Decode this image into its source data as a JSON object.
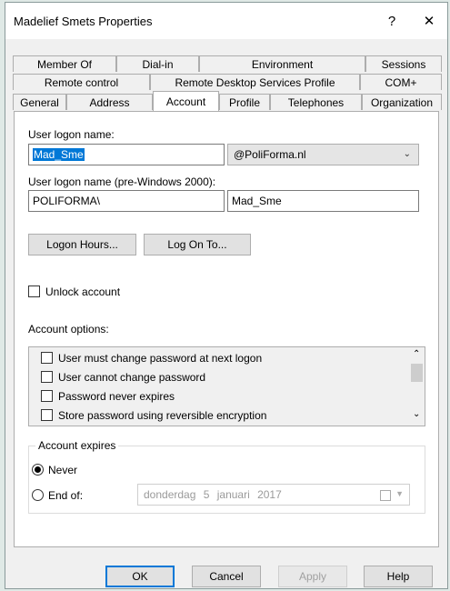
{
  "window": {
    "title": "Madelief Smets Properties",
    "help_label": "?",
    "close_label": "✕"
  },
  "tabs": {
    "row1": [
      "Member Of",
      "Dial-in",
      "Environment",
      "Sessions"
    ],
    "row2": [
      "Remote control",
      "Remote Desktop Services Profile",
      "COM+"
    ],
    "row3": [
      "General",
      "Address",
      "Account",
      "Profile",
      "Telephones",
      "Organization"
    ],
    "active": "Account"
  },
  "account": {
    "logon_name_label": "User logon name:",
    "logon_name_value": "Mad_Sme",
    "domain_value": "@PoliForma.nl",
    "pre2000_label": "User logon name (pre-Windows 2000):",
    "pre2000_domain": "POLIFORMA\\",
    "pre2000_user": "Mad_Sme",
    "logon_hours_button": "Logon Hours...",
    "log_on_to_button": "Log On To...",
    "unlock_label": "Unlock account",
    "options_label": "Account options:",
    "options": [
      "User must change password at next logon",
      "User cannot change password",
      "Password never expires",
      "Store password using reversible encryption"
    ],
    "expires_label": "Account expires",
    "never_label": "Never",
    "end_of_label": "End of:",
    "end_date": "donderdag 5 januari 2017"
  },
  "buttons": {
    "ok": "OK",
    "cancel": "Cancel",
    "apply": "Apply",
    "help": "Help"
  },
  "colors": {
    "selection": "#0078d7",
    "dialog_bg": "#f0f0f0"
  }
}
